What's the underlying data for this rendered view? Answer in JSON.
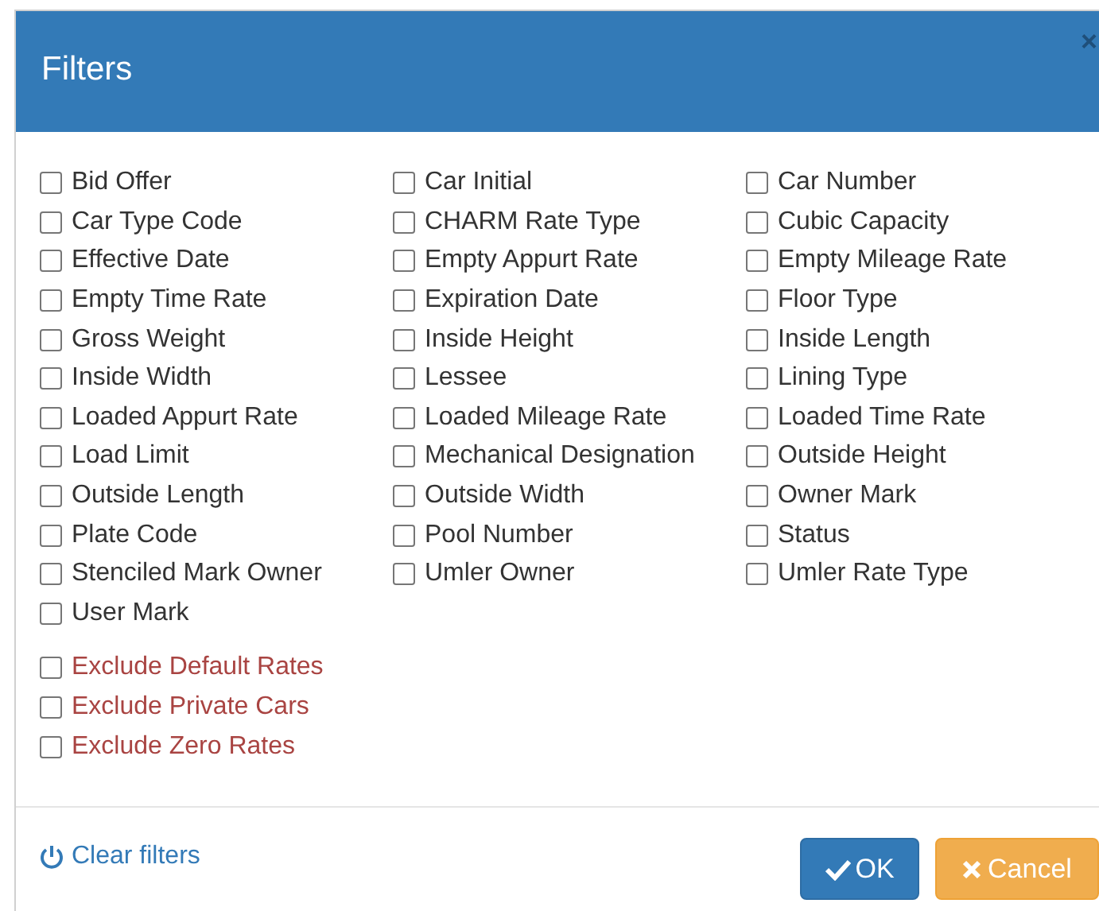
{
  "dialog": {
    "title": "Filters",
    "close": "×"
  },
  "filters": [
    {
      "label": "Bid Offer",
      "checked": false
    },
    {
      "label": "Car Initial",
      "checked": false
    },
    {
      "label": "Car Number",
      "checked": false
    },
    {
      "label": "Car Type Code",
      "checked": false
    },
    {
      "label": "CHARM Rate Type",
      "checked": false
    },
    {
      "label": "Cubic Capacity",
      "checked": false
    },
    {
      "label": "Effective Date",
      "checked": false
    },
    {
      "label": "Empty Appurt Rate",
      "checked": false
    },
    {
      "label": "Empty Mileage Rate",
      "checked": false
    },
    {
      "label": "Empty Time Rate",
      "checked": false
    },
    {
      "label": "Expiration Date",
      "checked": false
    },
    {
      "label": "Floor Type",
      "checked": false
    },
    {
      "label": "Gross Weight",
      "checked": false
    },
    {
      "label": "Inside Height",
      "checked": false
    },
    {
      "label": "Inside Length",
      "checked": false
    },
    {
      "label": "Inside Width",
      "checked": false
    },
    {
      "label": "Lessee",
      "checked": false
    },
    {
      "label": "Lining Type",
      "checked": false
    },
    {
      "label": "Loaded Appurt Rate",
      "checked": false
    },
    {
      "label": "Loaded Mileage Rate",
      "checked": false
    },
    {
      "label": "Loaded Time Rate",
      "checked": false
    },
    {
      "label": "Load Limit",
      "checked": false
    },
    {
      "label": "Mechanical Designation",
      "checked": false
    },
    {
      "label": "Outside Height",
      "checked": false
    },
    {
      "label": "Outside Length",
      "checked": false
    },
    {
      "label": "Outside Width",
      "checked": false
    },
    {
      "label": "Owner Mark",
      "checked": false
    },
    {
      "label": "Plate Code",
      "checked": false
    },
    {
      "label": "Pool Number",
      "checked": false
    },
    {
      "label": "Status",
      "checked": false
    },
    {
      "label": "Stenciled Mark Owner",
      "checked": false
    },
    {
      "label": "Umler Owner",
      "checked": false
    },
    {
      "label": "Umler Rate Type",
      "checked": false
    },
    {
      "label": "User Mark",
      "checked": false
    }
  ],
  "exclusions": [
    {
      "label": "Exclude Default Rates",
      "checked": false
    },
    {
      "label": "Exclude Private Cars",
      "checked": false
    },
    {
      "label": "Exclude Zero Rates",
      "checked": false
    }
  ],
  "footer": {
    "clear": "Clear filters",
    "ok": "OK",
    "cancel": "Cancel"
  }
}
